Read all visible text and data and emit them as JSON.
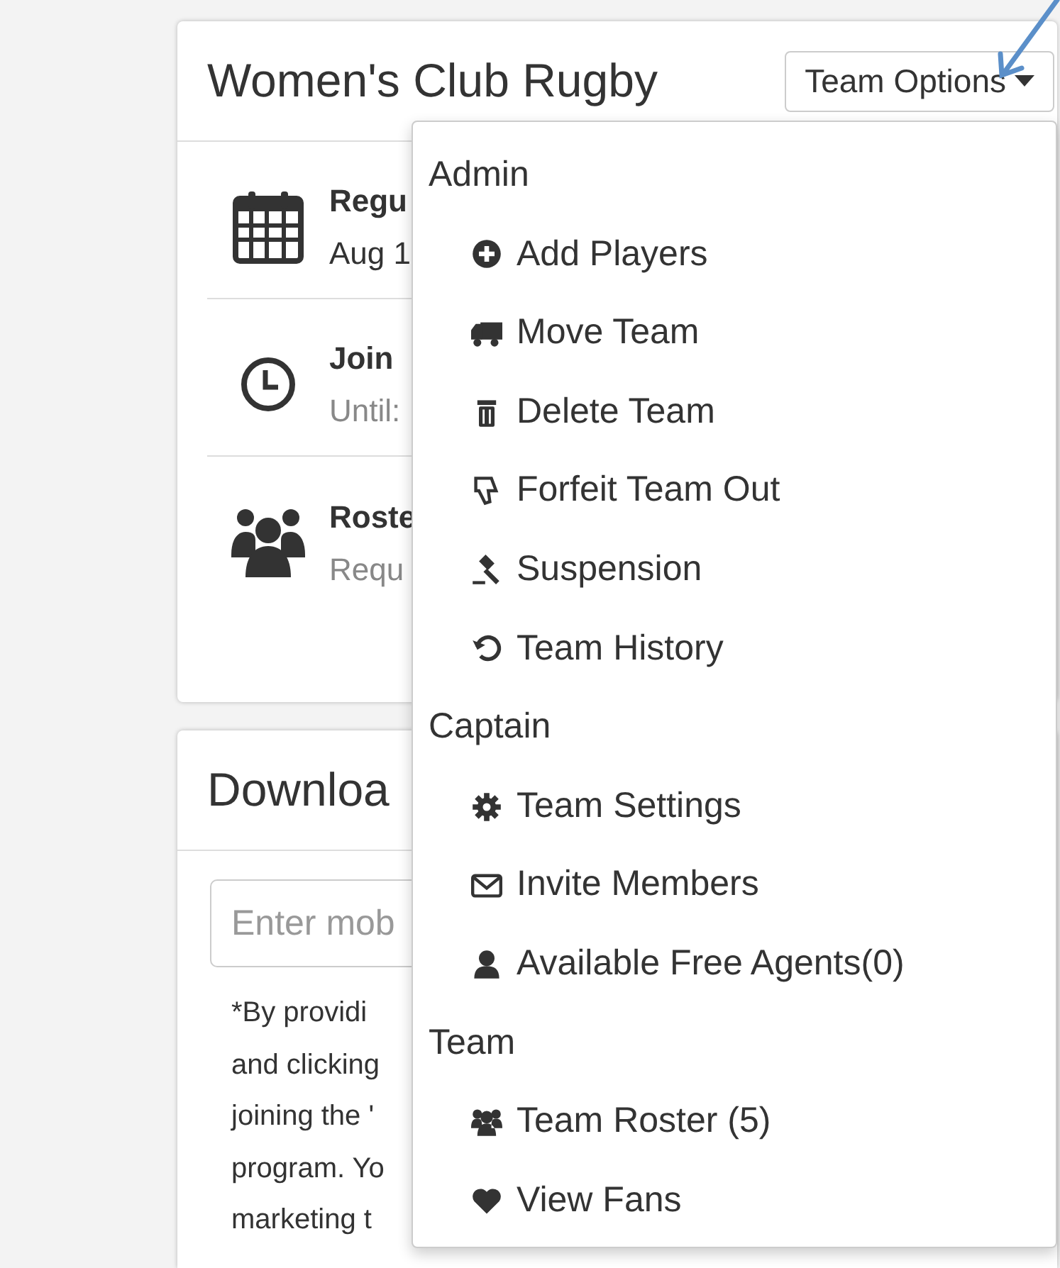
{
  "team_card": {
    "title": "Women's Club Rugby",
    "options_button": "Team Options",
    "rows": [
      {
        "title": "Regu",
        "detail": "Aug 1",
        "muted": false
      },
      {
        "title": "Join",
        "detail": "Until:",
        "muted": true
      },
      {
        "title": "Roste",
        "detail": "Requ",
        "muted": true
      }
    ]
  },
  "download_card": {
    "title": "Downloa",
    "phone_field": {
      "placeholder": "Enter mob"
    },
    "disclaimer_lines": [
      "*By providi",
      "and clicking",
      "joining the '",
      "program. Yo",
      "marketing t"
    ]
  },
  "team_options_menu": {
    "sections": [
      {
        "header": "Admin",
        "items": [
          "Add Players",
          "Move Team",
          "Delete Team",
          "Forfeit Team Out",
          "Suspension",
          "Team History"
        ]
      },
      {
        "header": "Captain",
        "items": [
          "Team Settings",
          "Invite Members",
          "Available Free Agents(0)"
        ]
      },
      {
        "header": "Team",
        "items": [
          "Team Roster (5)",
          "View Fans"
        ]
      }
    ]
  }
}
